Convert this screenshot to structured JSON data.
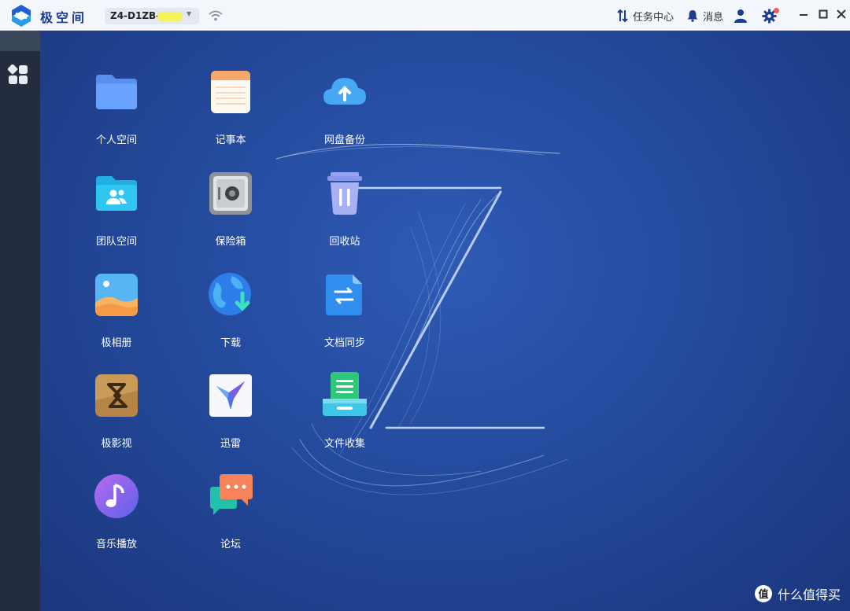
{
  "titlebar": {
    "app_name": "极空间",
    "device_name": "Z4-D1ZB-",
    "task_center": "任务中心",
    "messages": "消息"
  },
  "apps": [
    {
      "label": "个人空间",
      "icon": "folder-icon"
    },
    {
      "label": "记事本",
      "icon": "notepad-icon"
    },
    {
      "label": "网盘备份",
      "icon": "cloud-upload-icon"
    },
    {
      "label": "团队空间",
      "icon": "team-folder-icon"
    },
    {
      "label": "保险箱",
      "icon": "safe-icon"
    },
    {
      "label": "回收站",
      "icon": "trash-icon"
    },
    {
      "label": "极相册",
      "icon": "photo-album-icon"
    },
    {
      "label": "下载",
      "icon": "globe-download-icon"
    },
    {
      "label": "文档同步",
      "icon": "doc-sync-icon"
    },
    {
      "label": "极影视",
      "icon": "video-icon"
    },
    {
      "label": "迅雷",
      "icon": "thunder-bird-icon"
    },
    {
      "label": "文件收集",
      "icon": "file-collect-icon"
    },
    {
      "label": "音乐播放",
      "icon": "music-icon"
    },
    {
      "label": "论坛",
      "icon": "forum-icon"
    }
  ],
  "watermark": {
    "text": "什么值得买",
    "icon": "smzdm-logo-icon"
  },
  "colors": {
    "accent": "#1d3c8f",
    "desktop": "#244a9d",
    "sidebar": "#232d3f",
    "badge": "#f05a4f"
  }
}
